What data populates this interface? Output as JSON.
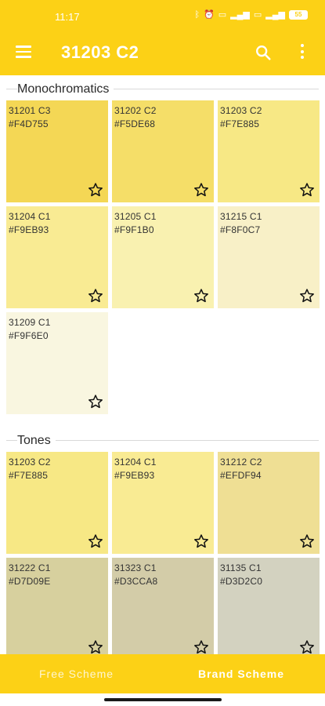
{
  "status": {
    "time": "11:17",
    "battery": "55"
  },
  "appbar": {
    "title": "31203 C2"
  },
  "sections": [
    {
      "label": "Monochromatics",
      "swatches": [
        {
          "code": "31201 C3",
          "hex": "#F4D755"
        },
        {
          "code": "31202 C2",
          "hex": "#F5DE68"
        },
        {
          "code": "31203 C2",
          "hex": "#F7E885"
        },
        {
          "code": "31204 C1",
          "hex": "#F9EB93"
        },
        {
          "code": "31205 C1",
          "hex": "#F9F1B0"
        },
        {
          "code": "31215 C1",
          "hex": "#F8F0C7"
        },
        {
          "code": "31209 C1",
          "hex": "#F9F6E0"
        }
      ]
    },
    {
      "label": "Tones",
      "swatches": [
        {
          "code": "31203 C2",
          "hex": "#F7E885"
        },
        {
          "code": "31204 C1",
          "hex": "#F9EB93"
        },
        {
          "code": "31212 C2",
          "hex": "#EFDF94"
        },
        {
          "code": "31222 C1",
          "hex": "#D7D09E"
        },
        {
          "code": "31323 C1",
          "hex": "#D3CCA8"
        },
        {
          "code": "31135 C1",
          "hex": "#D3D2C0"
        }
      ]
    }
  ],
  "bottom_tabs": {
    "free": "Free Scheme",
    "brand": "Brand Scheme"
  },
  "colors": {
    "accent": "#FCD116"
  }
}
